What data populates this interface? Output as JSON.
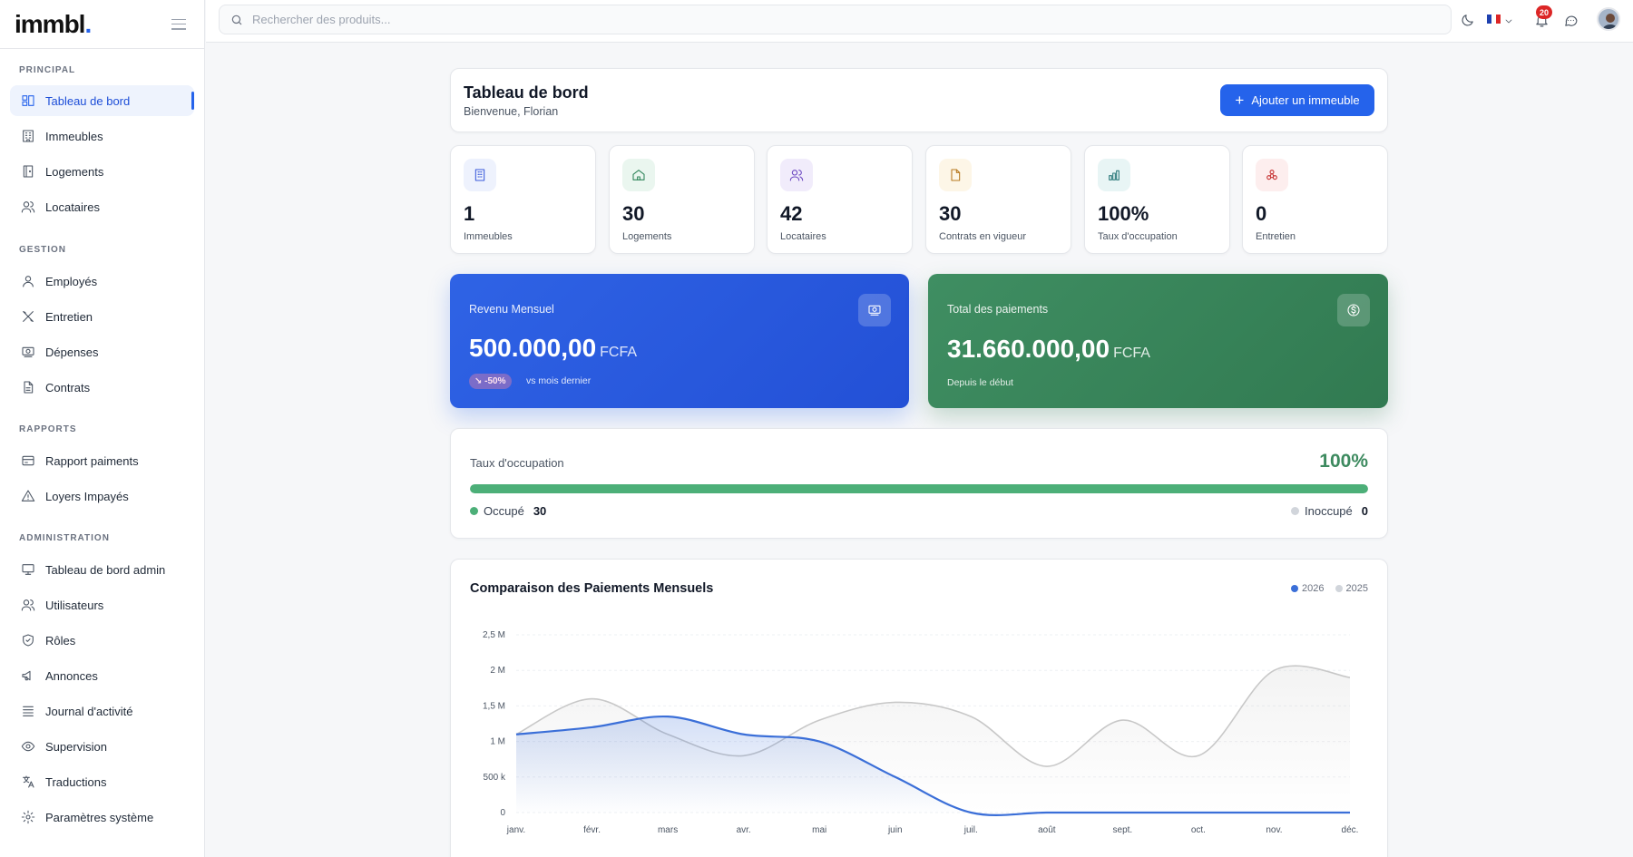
{
  "app": {
    "logo": "immbl",
    "logo_dot": "."
  },
  "search": {
    "placeholder": "Rechercher des produits..."
  },
  "notifications": {
    "count": "20"
  },
  "sidebar": {
    "sections": [
      {
        "label": "PRINCIPAL"
      },
      {
        "label": "GESTION"
      },
      {
        "label": "RAPPORTS"
      },
      {
        "label": "ADMINISTRATION"
      }
    ],
    "items": [
      {
        "label": "Tableau de bord",
        "icon": "dashboard-icon"
      },
      {
        "label": "Immeubles",
        "icon": "building-icon"
      },
      {
        "label": "Logements",
        "icon": "door-icon"
      },
      {
        "label": "Locataires",
        "icon": "users-icon"
      },
      {
        "label": "Employés",
        "icon": "user-icon"
      },
      {
        "label": "Entretien",
        "icon": "tools-icon"
      },
      {
        "label": "Dépenses",
        "icon": "money-icon"
      },
      {
        "label": "Contrats",
        "icon": "file-icon"
      },
      {
        "label": "Rapport paiments",
        "icon": "credit-card-icon"
      },
      {
        "label": "Loyers Impayés",
        "icon": "warning-icon"
      },
      {
        "label": "Tableau de bord admin",
        "icon": "monitor-icon"
      },
      {
        "label": "Utilisateurs",
        "icon": "users-icon"
      },
      {
        "label": "Rôles",
        "icon": "shield-icon"
      },
      {
        "label": "Annonces",
        "icon": "megaphone-icon"
      },
      {
        "label": "Journal d'activité",
        "icon": "list-icon"
      },
      {
        "label": "Supervision",
        "icon": "eye-icon"
      },
      {
        "label": "Traductions",
        "icon": "translate-icon"
      },
      {
        "label": "Paramètres système",
        "icon": "gear-icon"
      }
    ]
  },
  "header": {
    "title": "Tableau de bord",
    "subtitle": "Bienvenue, Florian",
    "add_button": "Ajouter un immeuble"
  },
  "stats": [
    {
      "value": "1",
      "label": "Immeubles",
      "icon": "building-icon",
      "color": "#3b5bdb",
      "bg": "#eef2fd"
    },
    {
      "value": "30",
      "label": "Logements",
      "icon": "home-icon",
      "color": "#2f855a",
      "bg": "#eaf6ef"
    },
    {
      "value": "42",
      "label": "Locataires",
      "icon": "users-icon",
      "color": "#6b46c1",
      "bg": "#f1ecfb"
    },
    {
      "value": "30",
      "label": "Contrats en vigueur",
      "icon": "file-icon",
      "color": "#b7791f",
      "bg": "#fdf6e7"
    },
    {
      "value": "100%",
      "label": "Taux d'occupation",
      "icon": "bar-chart-icon",
      "color": "#2c7a7b",
      "bg": "#e8f5f5"
    },
    {
      "value": "0",
      "label": "Entretien",
      "icon": "wrench-icon",
      "color": "#c53030",
      "bg": "#fdeeee"
    }
  ],
  "revenue": {
    "title": "Revenu Mensuel",
    "value": "500.000,00",
    "unit": "FCFA",
    "change": "↘ -50%",
    "note": "vs mois dernier",
    "color": "#2f63e5"
  },
  "payments": {
    "title": "Total des paiements",
    "value": "31.660.000,00",
    "unit": "FCFA",
    "note": "Depuis le début",
    "color": "#3f8e62"
  },
  "occupancy": {
    "title": "Taux d'occupation",
    "percent": "100%",
    "fill": 1.0,
    "occupied_label": "Occupé",
    "occupied_value": "30",
    "vacant_label": "Inoccupé",
    "vacant_value": "0",
    "color": "#4caf78"
  },
  "chart": {
    "title": "Comparaison des Paiements Mensuels"
  },
  "chart_data": {
    "type": "area",
    "categories": [
      "janv.",
      "févr.",
      "mars",
      "avr.",
      "mai",
      "juin",
      "juil.",
      "août",
      "sept.",
      "oct.",
      "nov.",
      "déc."
    ],
    "series": [
      {
        "name": "2026",
        "color": "#3b6fd8",
        "values": [
          1100000,
          1200000,
          1350000,
          1100000,
          1000000,
          500000,
          0,
          0,
          0,
          0,
          0,
          0
        ]
      },
      {
        "name": "2025",
        "color": "#c8c8c8",
        "values": [
          1100000,
          1600000,
          1100000,
          800000,
          1300000,
          1550000,
          1350000,
          650000,
          1300000,
          800000,
          2000000,
          1900000
        ]
      }
    ],
    "yticks": [
      "0",
      "500 k",
      "1 M",
      "1,5 M",
      "2 M",
      "2,5 M"
    ],
    "ylim": [
      0,
      2500000
    ],
    "legend_position": "top-right",
    "grid": true
  }
}
